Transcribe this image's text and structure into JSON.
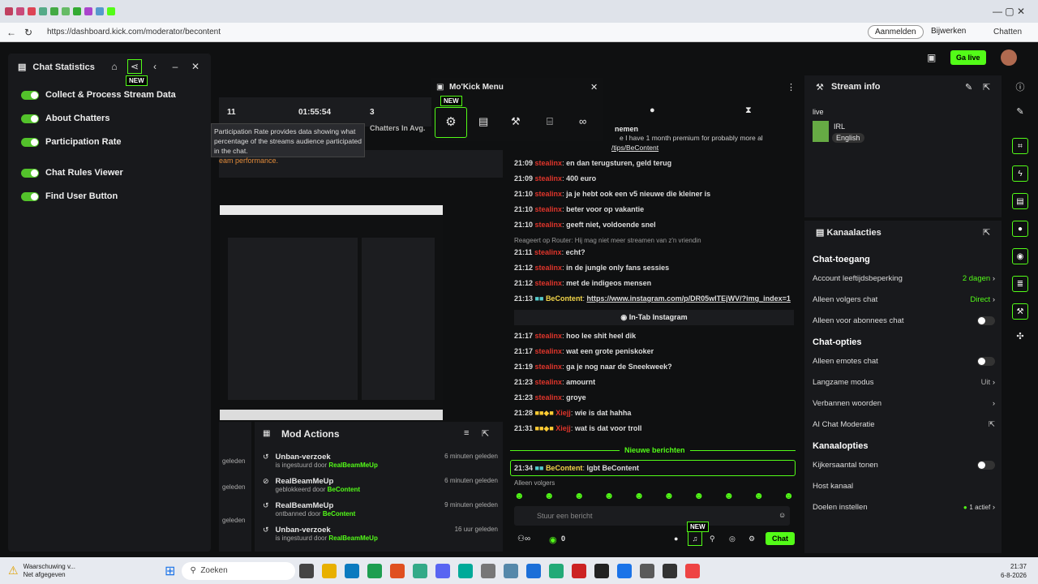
{
  "browser": {
    "url": "https://dashboard.kick.com/moderator/becontent",
    "signin_label": "Aanmelden",
    "update_label": "Bijwerken",
    "chats_label": "Chatten"
  },
  "topbar": {
    "golive_label": "Ga live"
  },
  "chat_stats": {
    "title": "Chat Statistics",
    "new_badge": "NEW",
    "items": [
      {
        "label": "Collect & Process Stream Data"
      },
      {
        "label": "About Chatters"
      },
      {
        "label": "Participation Rate"
      },
      {
        "label": "Chat Rules Viewer"
      },
      {
        "label": "Find User Button"
      }
    ]
  },
  "stats_bar": {
    "count": "11",
    "uptime": "01:55:54",
    "chatters_value": "3",
    "chatters_label": "Chatters In Avg."
  },
  "tooltip": {
    "text": "Participation Rate provides data showing what percentage of the streams audience participated in the chat.",
    "perf_text": "eam performance."
  },
  "mokick": {
    "title": "Mo'Kick Menu",
    "new_badge": "NEW"
  },
  "chat": {
    "pinned_name": "nemen",
    "pinned_text": "e I have 1 month premium for probably more al",
    "pinned_link": "/tips/BeContent",
    "lines": [
      {
        "time": "21:09",
        "user": "stealinx",
        "msg": "en dan terugsturen, geld terug"
      },
      {
        "time": "21:09",
        "user": "stealinx",
        "msg": "400 euro"
      },
      {
        "time": "21:10",
        "user": "stealinx",
        "msg": "ja je hebt ook een v5 nieuwe die kleiner is"
      },
      {
        "time": "21:10",
        "user": "stealinx",
        "msg": "beter voor op vakantie"
      },
      {
        "time": "21:10",
        "user": "stealinx",
        "msg": "geeft niet, voldoende snel"
      }
    ],
    "reply_text": "Reageert op Router: Hij mag niet meer streamen van z'n vriendin",
    "lines2": [
      {
        "time": "21:11",
        "user": "stealinx",
        "msg": "echt?"
      },
      {
        "time": "21:12",
        "user": "stealinx",
        "msg": "in de jungle only fans sessies"
      },
      {
        "time": "21:12",
        "user": "stealinx",
        "msg": "met de indigeos mensen"
      }
    ],
    "link_time": "21:13",
    "link_user": "BeContent",
    "link_url": "https://www.instagram.com/p/DR05wlTEjWV/?img_index=1",
    "intab_label": "In-Tab Instagram",
    "lines3": [
      {
        "time": "21:17",
        "user": "stealinx",
        "msg": "hoo lee shit heel dik"
      },
      {
        "time": "21:17",
        "user": "stealinx",
        "msg": "wat een grote peniskoker"
      },
      {
        "time": "21:19",
        "user": "stealinx",
        "msg": "ga je nog naar de Sneekweek?"
      },
      {
        "time": "21:23",
        "user": "stealinx",
        "msg": "amournt"
      },
      {
        "time": "21:23",
        "user": "stealinx",
        "msg": "groye"
      }
    ],
    "lines4": [
      {
        "time": "21:28",
        "user": "Xiejj",
        "msg": "wie is dat hahha"
      },
      {
        "time": "21:31",
        "user": "Xiejj",
        "msg": "wat is dat voor troll"
      }
    ],
    "new_messages_label": "Nieuwe berichten",
    "last_time": "21:34",
    "last_user": "BeContent",
    "last_msg": "lgbt BeContent",
    "followers_only": "Alleen volgers",
    "input_placeholder": "Stuur een bericht",
    "viewer_count": "0",
    "send_label": "Chat",
    "new_badge": "NEW"
  },
  "mod_actions": {
    "title": "Mod Actions",
    "geleden": "geleden",
    "items": [
      {
        "title": "Unban-verzoek",
        "desc": "is ingestuurd door",
        "by": "RealBeamMeUp",
        "time": "6 minuten geleden"
      },
      {
        "title": "RealBeamMeUp",
        "desc": "geblokkeerd door",
        "by": "BeContent",
        "time": "6 minuten geleden"
      },
      {
        "title": "RealBeamMeUp",
        "desc": "ontbanned door",
        "by": "BeContent",
        "time": "9 minuten geleden"
      },
      {
        "title": "Unban-verzoek",
        "desc": "is ingestuurd door",
        "by": "RealBeamMeUp",
        "time": "16 uur geleden"
      }
    ]
  },
  "stream_info": {
    "title": "Stream info",
    "status": "live",
    "category": "IRL",
    "language": "English"
  },
  "channel_actions": {
    "title": "Kanaalacties",
    "chat_access": "Chat-toegang",
    "age": {
      "label": "Account leeftijdsbeperking",
      "value": "2 dagen"
    },
    "followers": {
      "label": "Alleen volgers chat",
      "value": "Direct"
    },
    "subs": {
      "label": "Alleen voor abonnees chat"
    },
    "chat_options": "Chat-opties",
    "emotes": {
      "label": "Alleen emotes chat"
    },
    "slow": {
      "label": "Langzame modus",
      "value": "Uit"
    },
    "banned_words": {
      "label": "Verbannen woorden"
    },
    "ai_mod": {
      "label": "AI Chat Moderatie"
    },
    "channel_options": "Kanaalopties",
    "viewer_count": {
      "label": "Kijkersaantal tonen"
    },
    "host": {
      "label": "Host kanaal"
    },
    "goals": {
      "label": "Doelen instellen",
      "value": "1 actief"
    }
  },
  "taskbar": {
    "warning_title": "Waarschuwing v...",
    "warning_sub": "Net afgegeven",
    "search_placeholder": "Zoeken",
    "time": "21:37",
    "date": "6-8-2026"
  }
}
